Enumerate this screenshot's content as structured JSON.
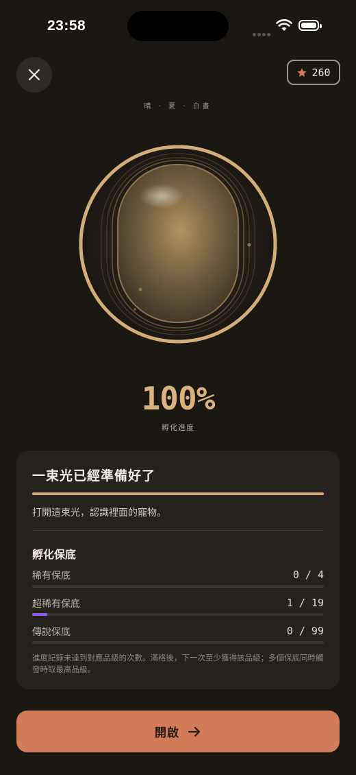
{
  "status_bar": {
    "time": "23:58"
  },
  "header": {
    "points": "260"
  },
  "environment": {
    "weather": "晴",
    "season": "夏",
    "daytime": "白晝",
    "separator": "·"
  },
  "progress": {
    "value_text": "100%",
    "label": "孵化進度",
    "value": 100
  },
  "card": {
    "title": "一束光已經準備好了",
    "description": "打開這束光，認識裡面的寵物。",
    "pity": {
      "title": "孵化保底",
      "rows": [
        {
          "label": "稀有保底",
          "value_text": "0 / 4",
          "current": 0,
          "max": 4
        },
        {
          "label": "超稀有保底",
          "value_text": "1 / 19",
          "current": 1,
          "max": 19
        },
        {
          "label": "傳說保底",
          "value_text": "0 / 99",
          "current": 0,
          "max": 99
        }
      ],
      "note": "進度記錄未達到對應品級的次數。滿格後，下一次至少獲得該品級；多個保底同時觸發時取最高品級。"
    }
  },
  "action": {
    "open_label": "開啟"
  },
  "colors": {
    "accent": "#d27c5a",
    "gold": "#d2ad79",
    "purple": "#8b5cf6",
    "background": "#1b1713"
  },
  "icons": {
    "close": "close-icon",
    "star": "star-icon",
    "arrow": "arrow-right-icon"
  }
}
